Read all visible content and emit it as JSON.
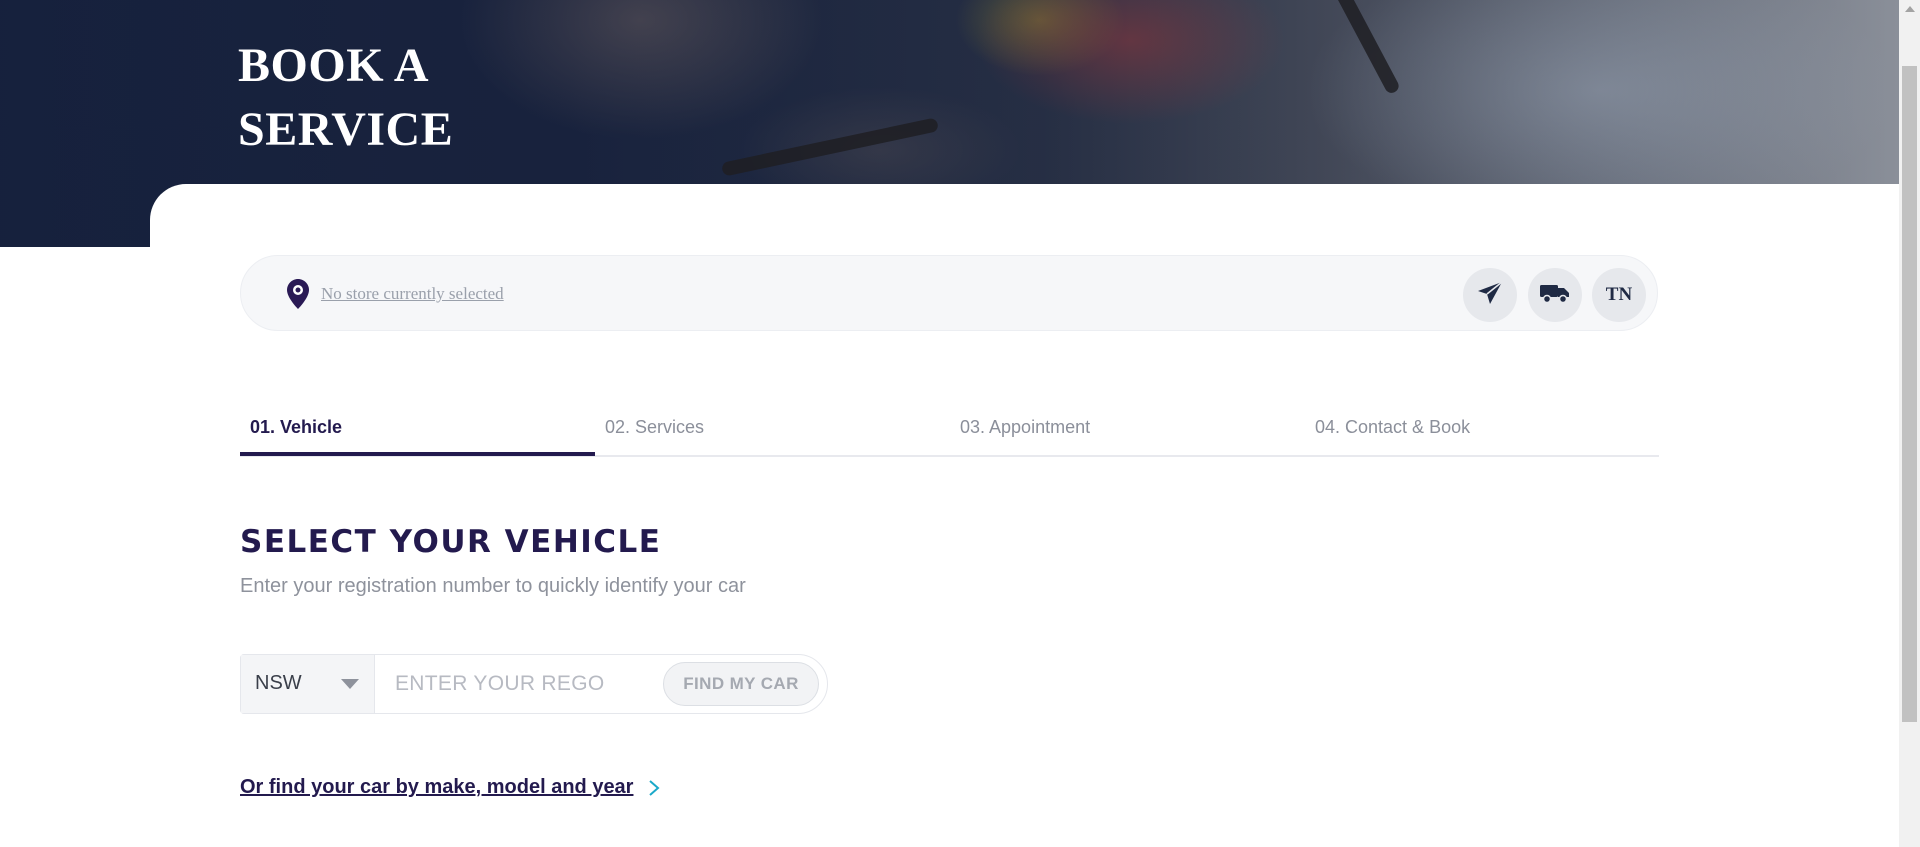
{
  "hero": {
    "title_line1": "BOOK A",
    "title_line2": "SERVICE"
  },
  "store_bar": {
    "store_text": "No store currently selected",
    "location_icon": "location-pin-icon",
    "actions": [
      {
        "name": "send-icon"
      },
      {
        "name": "truck-icon"
      },
      {
        "name": "TN"
      }
    ]
  },
  "tabs": [
    {
      "label": "01. Vehicle",
      "active": true
    },
    {
      "label": "02. Services",
      "active": false
    },
    {
      "label": "03. Appointment",
      "active": false
    },
    {
      "label": "04. Contact & Book",
      "active": false
    }
  ],
  "vehicle": {
    "title": "SELECT YOUR VEHICLE",
    "subtitle": "Enter your registration number to quickly identify your car",
    "state_selected": "NSW",
    "rego_placeholder": "ENTER YOUR REGO",
    "find_button": "FIND MY CAR",
    "alt_link": "Or find your car by make, model and year"
  },
  "colors": {
    "brand": "#231a4e",
    "muted": "#8e929c",
    "bar_bg": "#f6f7f9"
  }
}
